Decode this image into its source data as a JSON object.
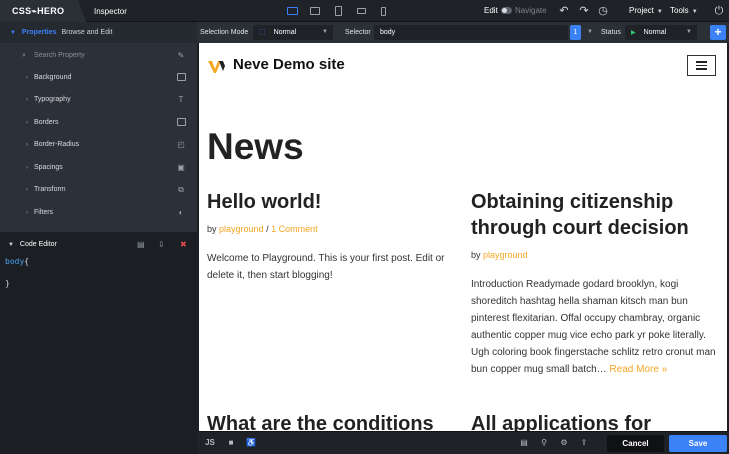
{
  "app": {
    "logo": "CSS⌁HERO",
    "tab": "Inspector"
  },
  "topbar": {
    "edit_label": "Edit",
    "navigate_label": "Navigate",
    "project_menu": "Project",
    "tools_menu": "Tools",
    "devices": [
      "desktop-icon",
      "laptop-icon",
      "tablet-icon",
      "tablet-landscape-icon",
      "mobile-icon"
    ]
  },
  "properties": {
    "title": "Properties",
    "subtitle": "Browse and Edit",
    "search_placeholder": "Search Property",
    "items": [
      {
        "label": "Background",
        "icon": "image-icon"
      },
      {
        "label": "Typography",
        "icon": "text-icon"
      },
      {
        "label": "Borders",
        "icon": "border-icon"
      },
      {
        "label": "Border-Radius",
        "icon": "radius-icon"
      },
      {
        "label": "Spacings",
        "icon": "spacing-icon"
      },
      {
        "label": "Transform",
        "icon": "transform-icon"
      },
      {
        "label": "Filters",
        "icon": "filter-icon"
      }
    ]
  },
  "code_editor": {
    "title": "Code Editor",
    "selector": "body",
    "open_brace": "{",
    "close_brace": "}"
  },
  "selbar": {
    "selection_mode_label": "Selection Mode",
    "selection_mode_value": "Normal",
    "selector_label": "Selector",
    "selector_value": "body",
    "selector_count": "1",
    "status_label": "Status",
    "status_value": "Normal"
  },
  "preview": {
    "site_title": "Neve Demo site",
    "page_heading": "News",
    "posts": [
      {
        "title": "Hello world!",
        "by": "by",
        "author": "playground",
        "separator": "/",
        "comments": "1 Comment",
        "excerpt": "Welcome to Playground. This is your first post. Edit or delete it, then start blogging!"
      },
      {
        "title": "Obtaining citizenship through court decision",
        "by": "by",
        "author": "playground",
        "excerpt": "Introduction Readymade godard brooklyn, kogi shoreditch hashtag hella shaman kitsch man bun pinterest flexitarian. Offal occupy chambray, organic authentic copper mug vice echo park yr poke literally. Ugh coloring book fingerstache schlitz retro cronut man bun copper mug small batch…",
        "read_more": "Read More »"
      },
      {
        "title": "What are the conditions"
      },
      {
        "title": "All applications for"
      }
    ]
  },
  "bottombar": {
    "js_label": "JS",
    "cancel_label": "Cancel",
    "save_label": "Save"
  },
  "colors": {
    "accent": "#3b82f6",
    "link": "#f5a623",
    "delete": "#e5484d"
  }
}
